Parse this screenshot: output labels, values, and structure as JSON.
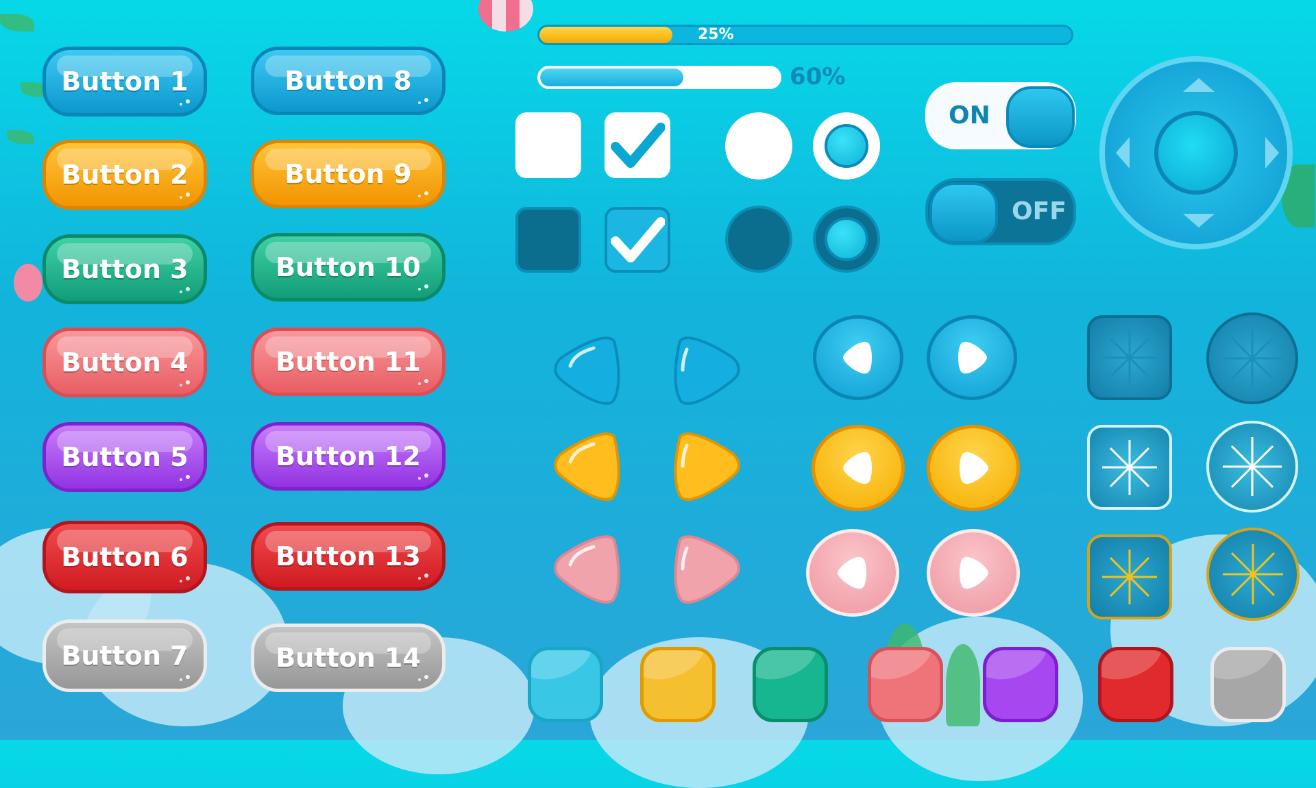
{
  "buttons_left": [
    {
      "label": "Button 1",
      "color": "#17aee0"
    },
    {
      "label": "Button 2",
      "color": "#ffa500"
    },
    {
      "label": "Button 3",
      "color": "#1fb489"
    },
    {
      "label": "Button 4",
      "color": "#ef7377"
    },
    {
      "label": "Button 5",
      "color": "#a94cef"
    },
    {
      "label": "Button 6",
      "color": "#e2272c"
    },
    {
      "label": "Button 7",
      "color": "#a9a9a9"
    }
  ],
  "buttons_right": [
    {
      "label": "Button 8",
      "color": "#17aee0"
    },
    {
      "label": "Button 9",
      "color": "#ffa500"
    },
    {
      "label": "Button 10",
      "color": "#1fb489"
    },
    {
      "label": "Button 11",
      "color": "#ef7377"
    },
    {
      "label": "Button 12",
      "color": "#a94cef"
    },
    {
      "label": "Button 13",
      "color": "#e2272c"
    },
    {
      "label": "Button 14",
      "color": "#a9a9a9"
    }
  ],
  "progress_bars": [
    {
      "percent_label": "25%",
      "value": 0.25
    },
    {
      "percent_label": "60%",
      "value": 0.6
    }
  ],
  "checkboxes": [
    {
      "style": "light",
      "checked": false
    },
    {
      "style": "light",
      "checked": true
    },
    {
      "style": "dark",
      "checked": false
    },
    {
      "style": "dark",
      "checked": true
    }
  ],
  "radios": [
    {
      "style": "light",
      "selected": false
    },
    {
      "style": "light",
      "selected": true
    },
    {
      "style": "dark",
      "selected": false
    },
    {
      "style": "dark",
      "selected": true
    }
  ],
  "toggles": {
    "on_label": "ON",
    "off_label": "OFF"
  },
  "joystick": {
    "icon": "dpad-joystick-icon",
    "color": "#22c4ea"
  },
  "arrow_buttons": [
    {
      "color": "#18b2e0",
      "icon": "left-arrow-icon"
    },
    {
      "color": "#18b2e0",
      "icon": "right-arrow-icon"
    },
    {
      "color": "#ffbd1e",
      "icon": "left-arrow-icon"
    },
    {
      "color": "#ffbd1e",
      "icon": "right-arrow-icon"
    },
    {
      "color": "#f0a3ab",
      "icon": "left-arrow-icon"
    },
    {
      "color": "#f0a3ab",
      "icon": "right-arrow-icon"
    }
  ],
  "play_buttons": [
    {
      "color": "#1aa9dd",
      "icon": "play-left-icon"
    },
    {
      "color": "#1aa9dd",
      "icon": "play-right-icon"
    },
    {
      "color": "#ffbe20",
      "icon": "play-left-icon"
    },
    {
      "color": "#ffbe20",
      "icon": "play-right-icon"
    },
    {
      "color": "#f4aab1",
      "icon": "play-left-icon"
    },
    {
      "color": "#f4aab1",
      "icon": "play-right-icon"
    }
  ],
  "glass_buttons": [
    {
      "shape": "square",
      "state": "normal",
      "ray_color": "#1b8fb8"
    },
    {
      "shape": "circle",
      "state": "normal",
      "ray_color": "#1b8fb8"
    },
    {
      "shape": "square",
      "state": "highlight",
      "ray_color": "#ffffff"
    },
    {
      "shape": "circle",
      "state": "highlight",
      "ray_color": "#ffffff"
    },
    {
      "shape": "square",
      "state": "gold",
      "ray_color": "#f3c21b"
    },
    {
      "shape": "circle",
      "state": "gold",
      "ray_color": "#f3c21b"
    }
  ],
  "square_buttons": [
    {
      "color": "#38c8e6"
    },
    {
      "color": "#f5c030"
    },
    {
      "color": "#16b690"
    },
    {
      "color": "#ef7479"
    },
    {
      "color": "#a747ef"
    },
    {
      "color": "#e12a2d"
    },
    {
      "color": "#a7a7a7"
    }
  ]
}
